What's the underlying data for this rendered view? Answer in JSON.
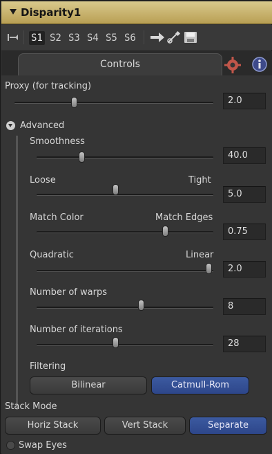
{
  "header": {
    "title": "Disparity1"
  },
  "toolbar": {
    "slots": [
      "S1",
      "S2",
      "S3",
      "S4",
      "S5",
      "S6"
    ],
    "active_slot": "S1"
  },
  "tabs": {
    "controls_label": "Controls"
  },
  "controls": {
    "proxy": {
      "label": "Proxy (for tracking)",
      "value": "2.0",
      "level": 0.24
    },
    "advanced_label": "Advanced",
    "smoothness": {
      "label": "Smoothness",
      "value": "40.0",
      "level": 0.27
    },
    "loose_tight": {
      "left": "Loose",
      "right": "Tight",
      "value": "5.0",
      "level": 0.48
    },
    "match": {
      "left": "Match Color",
      "right": "Match Edges",
      "value": "0.75",
      "level": 0.75
    },
    "quadratic_linear": {
      "left": "Quadratic",
      "right": "Linear",
      "value": "2.0",
      "level": 1.0
    },
    "warps": {
      "label": "Number of warps",
      "value": "8",
      "level": 0.6
    },
    "iterations": {
      "label": "Number of iterations",
      "value": "28",
      "level": 0.47
    },
    "filtering": {
      "label": "Filtering",
      "options": [
        "Bilinear",
        "Catmull-Rom"
      ],
      "selected": "Catmull-Rom"
    },
    "stack_mode": {
      "label": "Stack Mode",
      "options": [
        "Horiz Stack",
        "Vert Stack",
        "Separate"
      ],
      "selected": "Separate"
    },
    "swap_eyes": {
      "label": "Swap Eyes"
    }
  },
  "colors": {
    "header_gold": "#c9b56f",
    "selected_blue": "#3250a0",
    "panel_bg": "#353535"
  }
}
